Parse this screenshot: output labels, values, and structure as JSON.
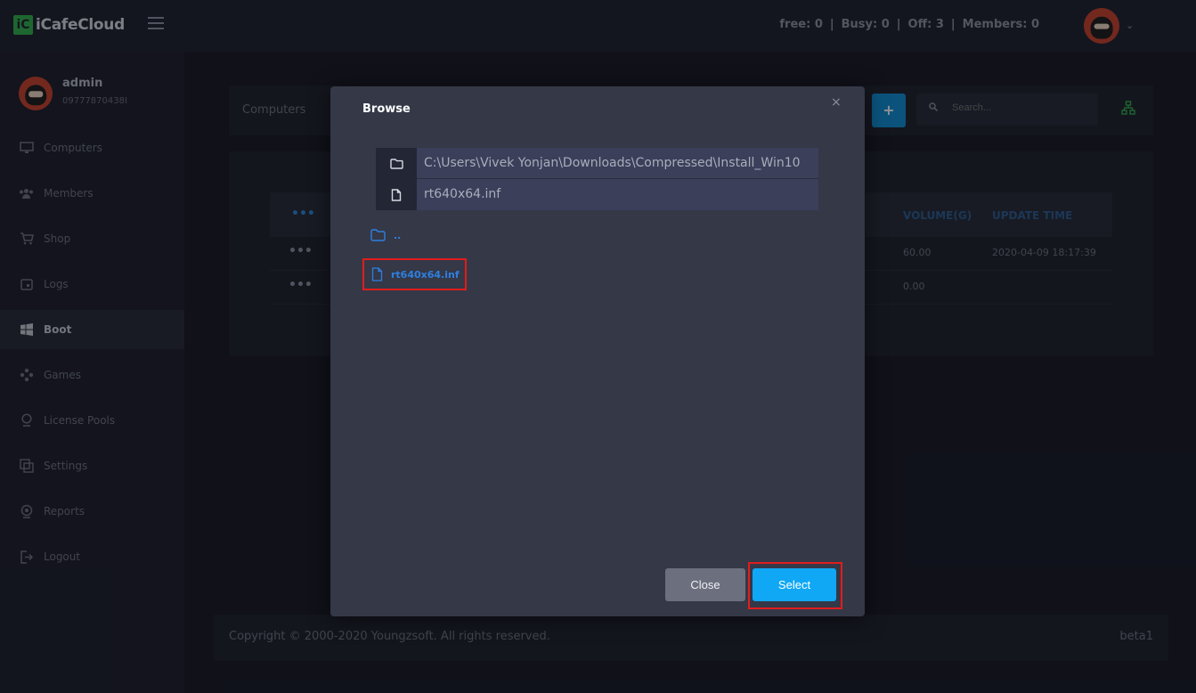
{
  "app": {
    "logo_mark": "iC",
    "logo_text": "iCafeCloud"
  },
  "header": {
    "stats": [
      {
        "label": "free:",
        "value": "0"
      },
      {
        "label": "Busy:",
        "value": "0"
      },
      {
        "label": "Off:",
        "value": "3"
      },
      {
        "label": "Members:",
        "value": "0"
      }
    ],
    "separator": "|",
    "caret": "⌄"
  },
  "user": {
    "name": "admin",
    "phone": "09777870438I"
  },
  "sidebar": {
    "items": [
      {
        "label": "Computers",
        "icon": "monitor-icon"
      },
      {
        "label": "Members",
        "icon": "users-icon"
      },
      {
        "label": "Shop",
        "icon": "cart-icon"
      },
      {
        "label": "Logs",
        "icon": "calendar-icon"
      },
      {
        "label": "Boot",
        "icon": "windows-icon",
        "active": true
      },
      {
        "label": "Games",
        "icon": "gamepad-icon"
      },
      {
        "label": "License Pools",
        "icon": "license-icon"
      },
      {
        "label": "Settings",
        "icon": "settings-icon"
      },
      {
        "label": "Reports",
        "icon": "reports-icon"
      },
      {
        "label": "Logout",
        "icon": "logout-icon"
      }
    ]
  },
  "toolbar": {
    "computers_label": "Computers",
    "add_label": "+",
    "search_placeholder": "Search..."
  },
  "table": {
    "header_dots": "•••",
    "columns": {
      "volume": "VOLUME(G)",
      "update": "UPDATE TIME"
    },
    "rows": [
      {
        "dots": "•••",
        "volume": "60.00",
        "update": "2020-04-09 18:17:39"
      },
      {
        "dots": "•••",
        "volume": "0.00",
        "update": ""
      }
    ]
  },
  "footer": {
    "copyright": "Copyright © 2000-2020 Youngzsoft. All rights reserved.",
    "version": "beta1"
  },
  "modal": {
    "title": "Browse",
    "close_x": "×",
    "path_value": "C:\\Users\\Vivek Yonjan\\Downloads\\Compressed\\Install_Win10",
    "file_value": "rt640x64.inf",
    "items": [
      {
        "label": "..",
        "icon": "folder-icon"
      },
      {
        "label": "rt640x64.inf",
        "icon": "file-icon"
      }
    ],
    "close_button": "Close",
    "select_button": "Select"
  },
  "colors": {
    "accent": "#10a8f5",
    "highlight": "#e11d1d",
    "link": "#2f7fe0",
    "logo": "#2fb24c"
  }
}
